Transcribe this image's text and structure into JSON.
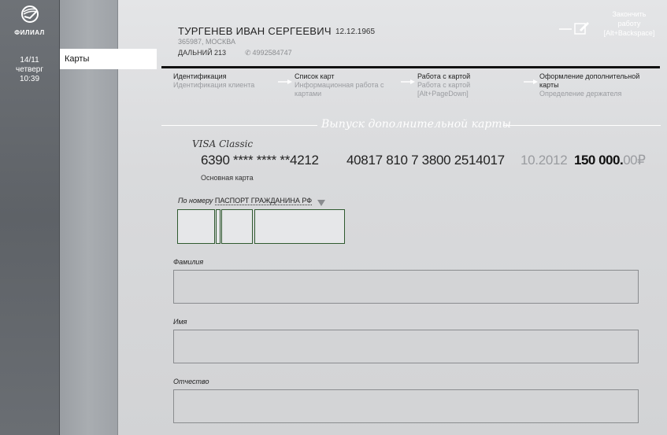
{
  "brand": {
    "logo_text": "ФИЛИАЛ"
  },
  "datetime": {
    "date": "14/11",
    "weekday": "четверг",
    "time": "10:39"
  },
  "nav": {
    "active_item": "Карты"
  },
  "client": {
    "name": "ТУРГЕНЕВ ИВАН СЕРГЕЕВИЧ",
    "dob": "12.12.1965",
    "address": "365987, МОСКВА",
    "office": "ДАЛЬНИЙ 213",
    "phone": "4992584747"
  },
  "finish": {
    "line1": "Закончить",
    "line2": "работу",
    "hotkey": "[Alt+Backspace]"
  },
  "steps": [
    {
      "title": "Идентификация",
      "sub1": "Идентификация клиента",
      "sub2": ""
    },
    {
      "title": "Список карт",
      "sub1": "Информационная работа с",
      "sub2": "картами"
    },
    {
      "title": "Работа с картой",
      "sub1": "Работа с картой",
      "sub2": "[Alt+PageDown]"
    },
    {
      "title": "Оформление дополнительной",
      "title2": "карты",
      "sub1": "Определение держателя"
    }
  ],
  "section": {
    "title": "Выпуск дополнительной карты"
  },
  "card": {
    "type": "VISA Classic",
    "number": "6390 **** **** **4212",
    "account": "40817 810 7 3800 2514017",
    "expiry": "10.2012",
    "amount_int": "150 000.",
    "amount_dec": "00",
    "currency": "₽",
    "kind": "Основная карта"
  },
  "document": {
    "label_prefix": "По номеру",
    "type": "ПАСПОРТ ГРАЖДАНИНА РФ"
  },
  "fields": {
    "last_name_label": "Фамилия",
    "first_name_label": "Имя",
    "patronymic_label": "Отчество"
  },
  "colors": {
    "rail": "#5e6267",
    "accent_line": "#111111",
    "input_border": "#2f5a2f"
  },
  "icons": {
    "logo": "bank-logo-icon",
    "finish": "pen-icon",
    "phone": "phone-icon",
    "dropdown": "triangle-down-icon"
  }
}
